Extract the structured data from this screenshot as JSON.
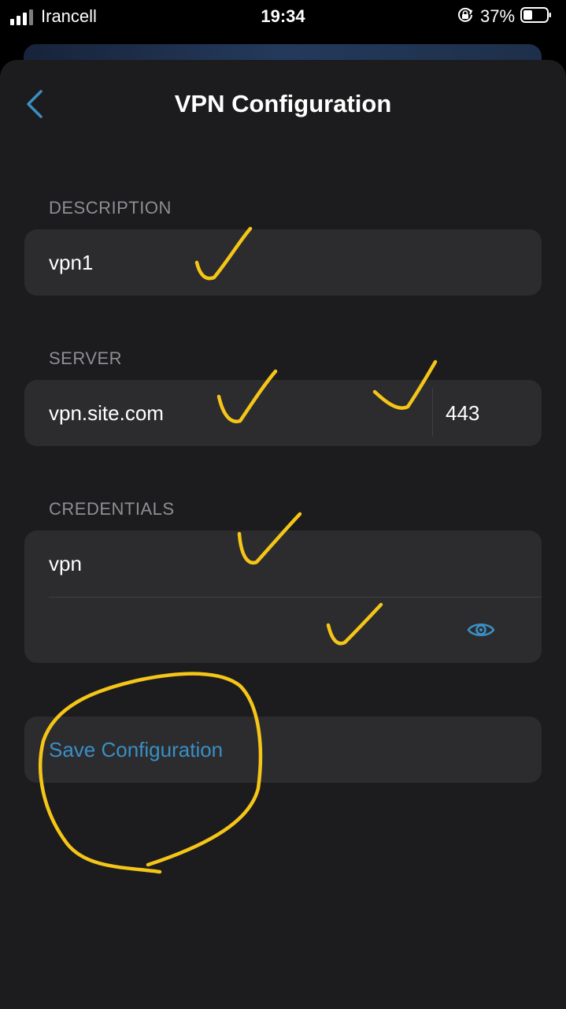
{
  "status_bar": {
    "carrier": "Irancell",
    "time": "19:34",
    "battery_percent": "37%",
    "icons": [
      "signal-icon",
      "rotation-lock-icon",
      "battery-icon"
    ]
  },
  "nav": {
    "title": "VPN Configuration",
    "back_icon": "chevron-left-icon"
  },
  "description": {
    "label": "DESCRIPTION",
    "value": "vpn1"
  },
  "server": {
    "label": "SERVER",
    "host": "vpn.site.com",
    "port": "443"
  },
  "credentials": {
    "label": "CREDENTIALS",
    "username": "vpn",
    "password": "",
    "reveal_icon": "eye-icon"
  },
  "save_button": {
    "label": "Save Configuration"
  },
  "colors": {
    "background": "#1c1c1e",
    "field": "#2c2c2e",
    "accent": "#3a8fc4",
    "annotation": "#f5c518"
  }
}
